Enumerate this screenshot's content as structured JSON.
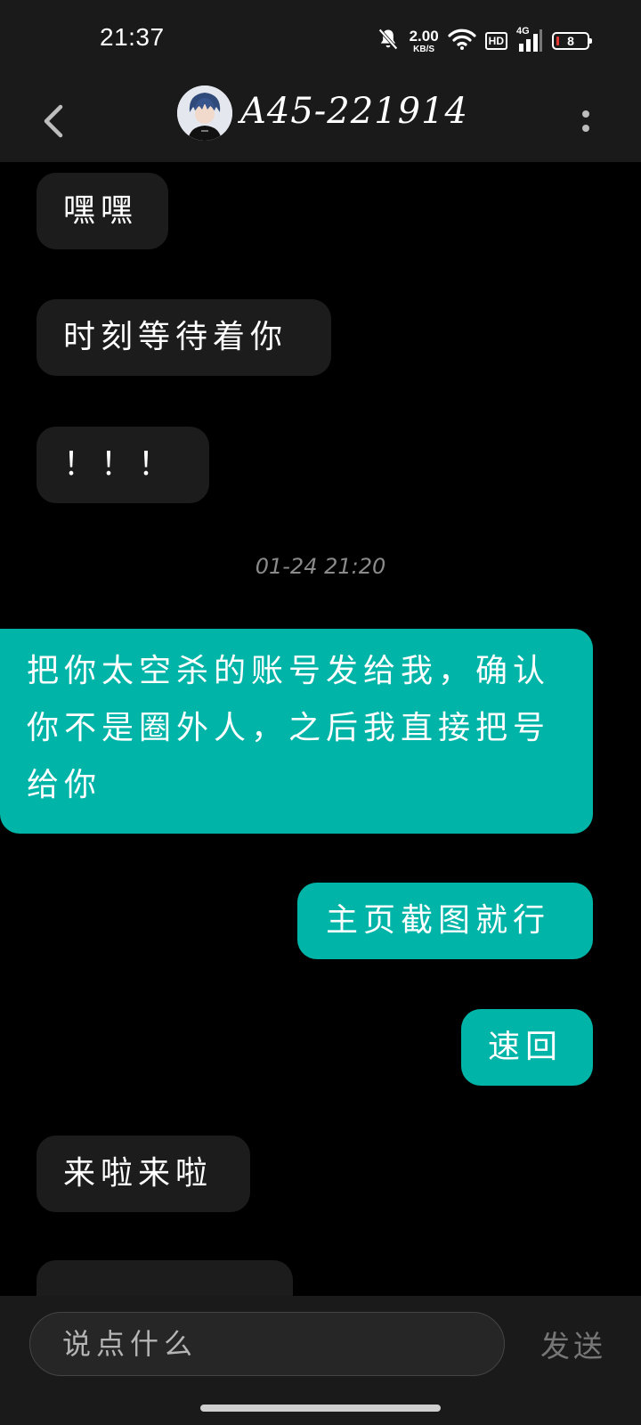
{
  "status_bar": {
    "time": "21:37",
    "net_speed_value": "2.00",
    "net_speed_unit": "KB/S",
    "hd_label": "HD",
    "network_label": "4G",
    "battery_level": "8"
  },
  "header": {
    "contact_name": "A45-221914",
    "back_icon": "chevron-left-icon",
    "more_icon": "more-vertical-icon"
  },
  "messages": [
    {
      "side": "in",
      "text": "嘿嘿"
    },
    {
      "side": "in",
      "text": "时刻等待着你"
    },
    {
      "side": "in",
      "text": "！！！"
    },
    {
      "side": "out",
      "text": "把你太空杀的账号发给我，确认你不是圈外人，之后我直接把号给你"
    },
    {
      "side": "out",
      "text": "主页截图就行"
    },
    {
      "side": "out",
      "text": "速回"
    },
    {
      "side": "in",
      "text": "来啦来啦"
    }
  ],
  "timestamp": "01-24 21:20",
  "input": {
    "placeholder": "说点什么",
    "send_label": "发送"
  },
  "colors": {
    "outgoing_bubble": "#00b5a8",
    "incoming_bubble": "#1c1c1c",
    "bar_background": "#1a1a1a",
    "chat_background": "#000000",
    "battery_low": "#e53935"
  }
}
